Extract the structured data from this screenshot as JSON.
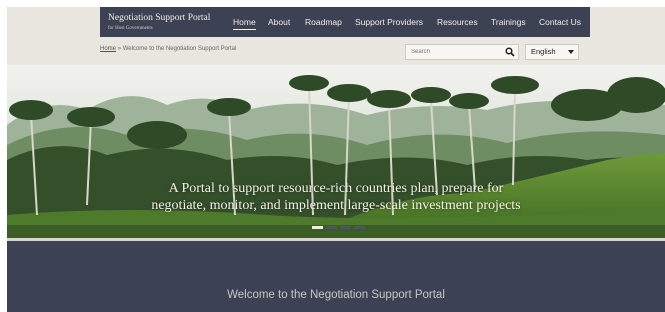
{
  "header": {
    "brand_title": "Negotiation Support Portal",
    "brand_subtitle": "for Host Governments",
    "nav": [
      {
        "label": "Home",
        "active": true
      },
      {
        "label": "About",
        "active": false
      },
      {
        "label": "Roadmap",
        "active": false
      },
      {
        "label": "Support Providers",
        "active": false
      },
      {
        "label": "Resources",
        "active": false
      },
      {
        "label": "Trainings",
        "active": false
      },
      {
        "label": "Contact Us",
        "active": false
      }
    ]
  },
  "breadcrumb": {
    "home": "Home",
    "separator": "»",
    "current": "Welcome to the Negotiation Support Portal"
  },
  "search": {
    "placeholder": "Search",
    "icon": "search-icon"
  },
  "language": {
    "selected": "English"
  },
  "hero": {
    "caption_line1": "A Portal to support resource-rich countries plan, prepare for",
    "caption_line2": "negotiate, monitor, and implement large-scale investment projects",
    "slides_total": 4,
    "slide_active": 1
  },
  "welcome": {
    "title": "Welcome to the Negotiation Support Portal"
  },
  "colors": {
    "navbar": "#3d4154",
    "page_bg": "#e8e6df",
    "text_light": "#f1ede4"
  }
}
